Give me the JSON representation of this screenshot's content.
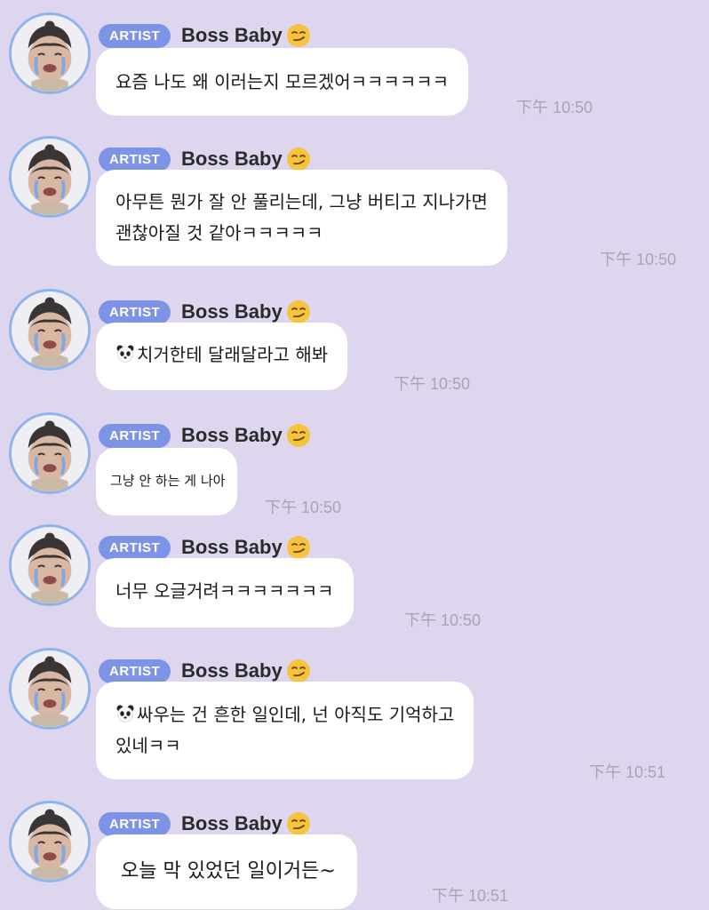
{
  "messages": [
    {
      "badge": "ARTIST",
      "sender": "Boss Baby",
      "lines": [
        "요즘 나도 왜 이러는지 모르겠어ㅋㅋㅋㅋㅋㅋ"
      ],
      "time": "下午 10:50"
    },
    {
      "badge": "ARTIST",
      "sender": "Boss Baby",
      "lines": [
        "아무튼 뭔가 잘 안 풀리는데, 그냥 버티고 지나가면",
        "괜찮아질 것 같아ㅋㅋㅋㅋㅋ"
      ],
      "time": "下午 10:50"
    },
    {
      "badge": "ARTIST",
      "sender": "Boss Baby",
      "lines": [
        "치거한테 달래달라고 해봐"
      ],
      "time": "下午 10:50",
      "prefix_icon": "panda-emoji-icon"
    },
    {
      "badge": "ARTIST",
      "sender": "Boss Baby",
      "lines": [
        "그냥 안 하는 게 나아"
      ],
      "time": "下午 10:50"
    },
    {
      "badge": "ARTIST",
      "sender": "Boss Baby",
      "lines": [
        "너무 오글거려ㅋㅋㅋㅋㅋㅋㅋ"
      ],
      "time": "下午 10:50"
    },
    {
      "badge": "ARTIST",
      "sender": "Boss Baby",
      "lines": [
        "싸우는 건 흔한 일인데, 넌 아직도 기억하고",
        "있네ㅋㅋ"
      ],
      "time": "下午 10:51",
      "prefix_icon": "panda-emoji-icon"
    },
    {
      "badge": "ARTIST",
      "sender": "Boss Baby",
      "lines": [
        "오늘 막 있었던 일이거든~"
      ],
      "time": "下午 10:51"
    }
  ],
  "colors": {
    "background": "#ddd6ee",
    "badge": "#7d94e6",
    "bubble": "#ffffff",
    "timestamp": "#a7a5ae",
    "avatar_ring": "#8fb4ec"
  },
  "icons": {
    "avatar": "baby-avatar-icon",
    "name_suffix": "smirk-emoji-icon"
  }
}
